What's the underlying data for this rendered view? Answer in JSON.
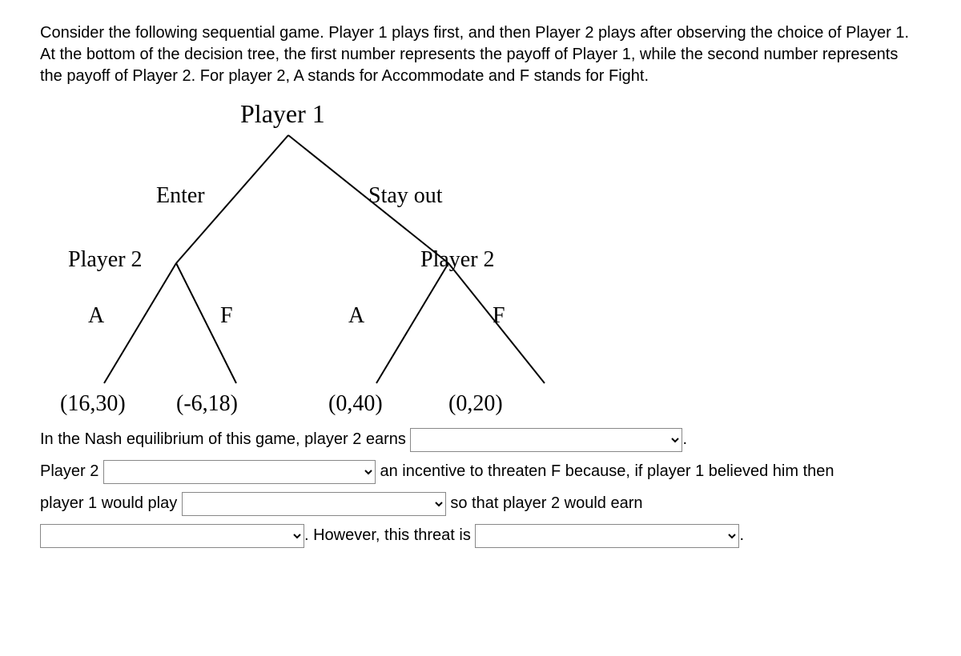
{
  "prompt": "Consider the following sequential game. Player 1 plays first, and then Player 2 plays after observing the choice of Player 1. At the bottom of the decision tree, the first number represents the payoff of Player 1, while the second number represents the payoff of Player 2. For player 2, A stands for Accommodate and F stands for Fight.",
  "tree": {
    "root": "Player 1",
    "p1_left": "Enter",
    "p1_right": "Stay out",
    "p2_left": "Player 2",
    "p2_right": "Player 2",
    "a": "A",
    "f": "F",
    "payoff_EA": "(16,30)",
    "payoff_EF": "(-6,18)",
    "payoff_SA": "(0,40)",
    "payoff_SF": "(0,20)"
  },
  "answers": {
    "line1a": "In the Nash equilibrium of this game, player 2 earns",
    "period": ".",
    "line2a": "Player 2",
    "line2b": "an incentive to threaten F because, if player 1 believed him then",
    "line3a": "player 1 would play",
    "line3b": "so that player 2 would earn",
    "line4a": ". However, this threat is"
  }
}
